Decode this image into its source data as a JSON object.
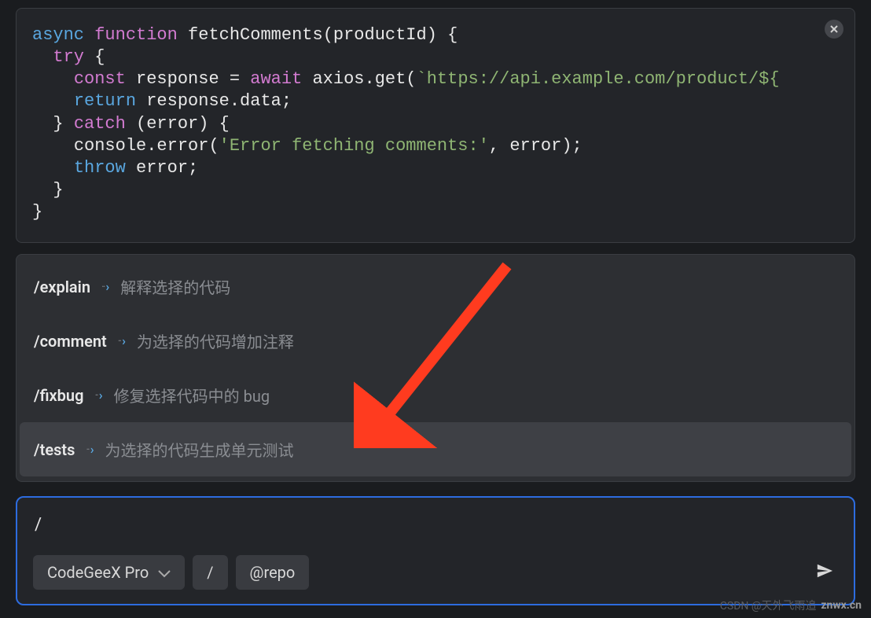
{
  "code": {
    "line1_async": "async",
    "line1_function": "function",
    "line1_name": "fetchComments",
    "line1_open": "(productId) {",
    "line2_try": "try",
    "line2_brace": " {",
    "line3_const": "const",
    "line3_var": " response = ",
    "line3_await": "await",
    "line3_call": " axios.get(",
    "line3_str": "`https://api.example.com/product/${",
    "line4_return": "return",
    "line4_rest": " response.data;",
    "line5_close": "} ",
    "line5_catch": "catch",
    "line5_rest": " (error) {",
    "line6_call": "console.error(",
    "line6_str": "'Error fetching comments:'",
    "line6_rest": ", error);",
    "line7_throw": "throw",
    "line7_rest": " error;",
    "line8": "}",
    "line9": "}"
  },
  "suggestions": [
    {
      "cmd": "/explain",
      "desc": "解释选择的代码",
      "selected": false
    },
    {
      "cmd": "/comment",
      "desc": "为选择的代码增加注释",
      "selected": false
    },
    {
      "cmd": "/fixbug",
      "desc": "修复选择代码中的 bug",
      "selected": false
    },
    {
      "cmd": "/tests",
      "desc": "为选择的代码生成单元测试",
      "selected": true
    }
  ],
  "input": {
    "value": "/",
    "model": "CodeGeeX Pro",
    "slash": "/",
    "repo": "@repo"
  },
  "watermark": {
    "prefix": "CSDN @天外飞雨追",
    "brand": "znwx.cn"
  }
}
